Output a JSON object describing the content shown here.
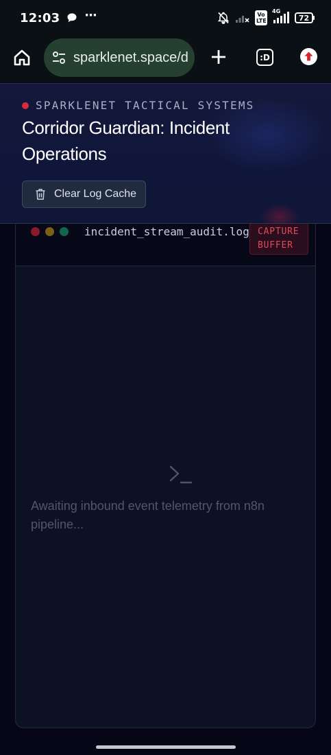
{
  "status_bar": {
    "time": "12:03",
    "more": "···",
    "network_label": "4G",
    "volte_label": "Vo LTE",
    "battery": "72"
  },
  "browser": {
    "url": "sparklenet.space/d",
    "tabs_label": ":D"
  },
  "header": {
    "eyebrow": "SPARKLENET TACTICAL SYSTEMS",
    "title": "Corridor Guardian: Incident Operations",
    "clear_button": "Clear Log Cache",
    "accent_color": "#d62c3c"
  },
  "terminal": {
    "file_name": "incident_stream_audit.log",
    "badge_line1": "CAPTURE",
    "badge_line2": "BUFFER",
    "empty_message": "Awaiting inbound event telemetry from n8n pipeline..."
  },
  "icons": [
    "chat-bubble-icon",
    "bell-off-icon",
    "signal-icon",
    "home-icon",
    "site-settings-icon",
    "plus-icon",
    "tabs-icon",
    "update-icon",
    "trash-icon",
    "terminal-prompt-icon"
  ]
}
